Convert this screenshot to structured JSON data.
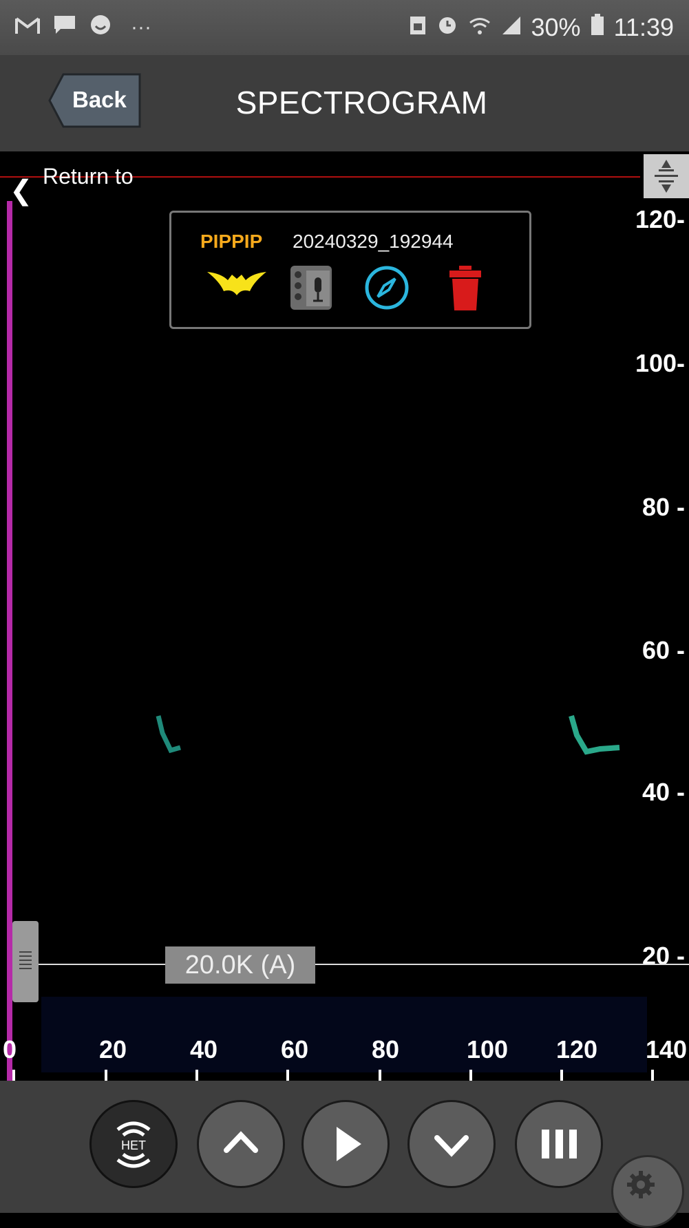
{
  "status_bar": {
    "battery": "30%",
    "time": "11:39",
    "more": "···"
  },
  "header": {
    "back_label": "Back",
    "title": "SPECTROGRAM"
  },
  "spectrogram": {
    "return_label": "Return to",
    "species": "PIPPIP",
    "filename": "20240329_192944",
    "threshold_label": "20.0K (A)",
    "y_axis_labels": [
      "120-",
      "100-",
      "80  -",
      "60  -",
      "40  -",
      "20  -"
    ],
    "x_axis_labels": [
      "0",
      "20",
      "40",
      "60",
      "80",
      "100",
      "120",
      "140"
    ]
  },
  "icons": {
    "species": "bat-icon",
    "recorder": "recorder-icon",
    "location": "compass-icon",
    "delete": "trash-icon",
    "resize": "resize-icon"
  },
  "controls": [
    "het-button",
    "up-button",
    "play-button",
    "down-button",
    "pause-button",
    "settings-button"
  ],
  "colors": {
    "accent_species": "#f5a91c",
    "marker_line": "#b52aa8",
    "location_icon": "#2bb6de",
    "delete_icon": "#d81b1b",
    "bat_icon": "#f7e21a"
  }
}
